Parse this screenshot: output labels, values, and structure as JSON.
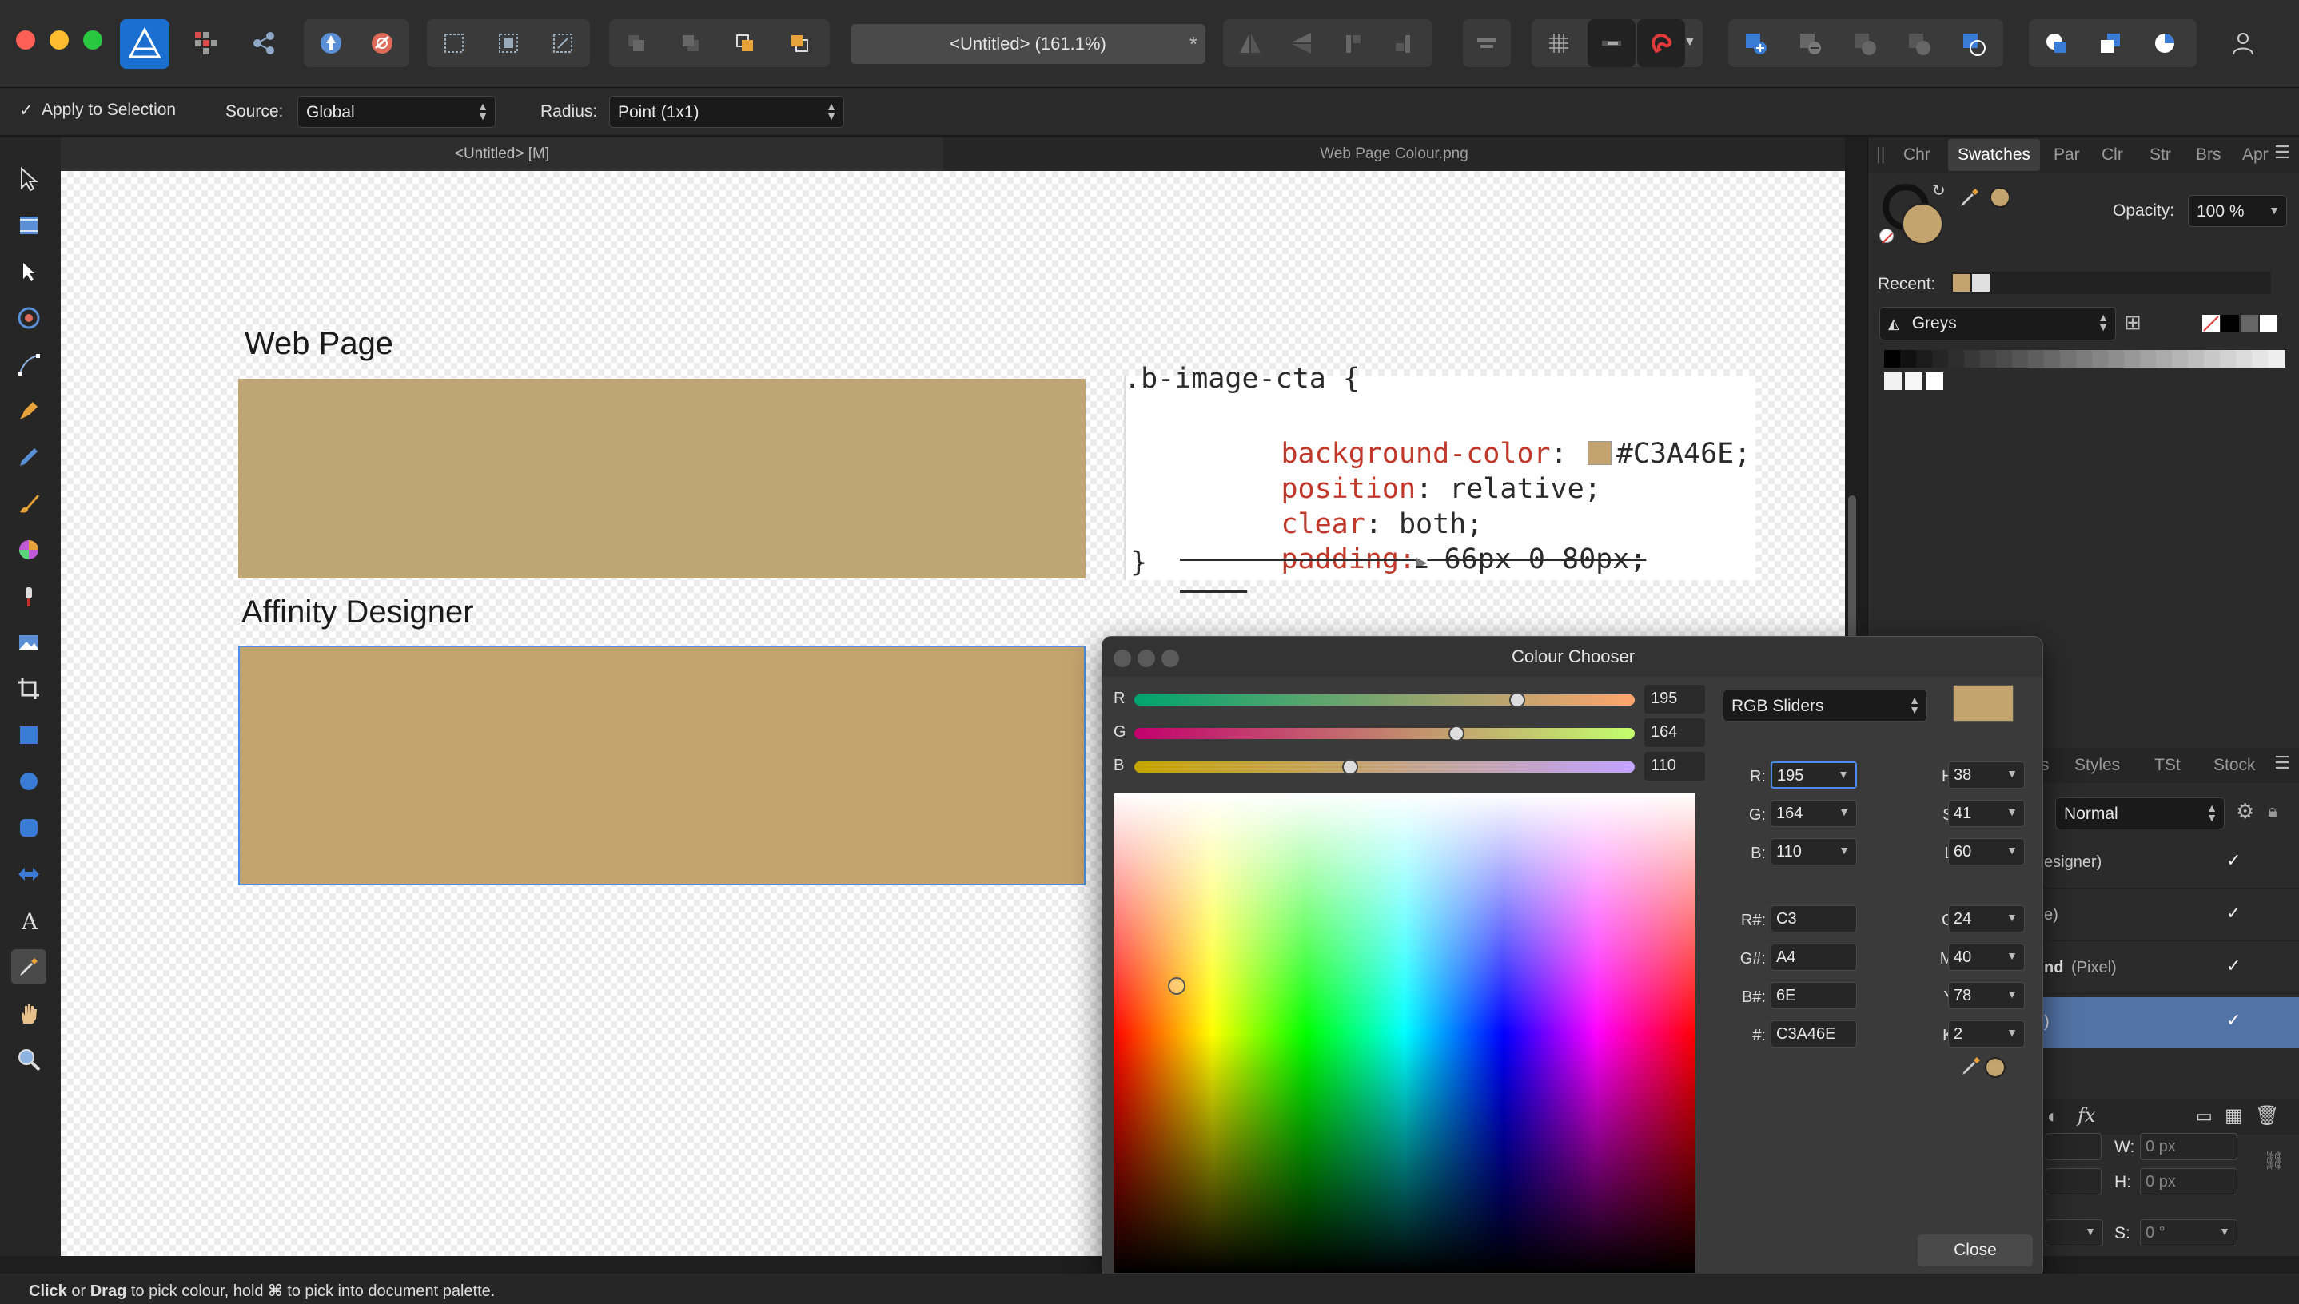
{
  "window": {
    "doc_title": "<Untitled> (161.1%)",
    "title_star": "*"
  },
  "context_bar": {
    "apply_label": "Apply to Selection",
    "apply_check": "✓",
    "source_label": "Source:",
    "source_value": "Global",
    "radius_label": "Radius:",
    "radius_value": "Point (1x1)"
  },
  "doc_tabs": [
    "<Untitled> [M]",
    "Web Page Colour.png"
  ],
  "canvas": {
    "heading_web": "Web Page",
    "heading_affinity": "Affinity Designer",
    "web_color": "#C3A46E",
    "affinity_color": "#C3A46E",
    "code": {
      "line0": ".b-image-cta {",
      "prop1": "background-color",
      "val1": "#C3A46E;",
      "prop2": "position",
      "val2": " relative;",
      "prop3": "clear",
      "val3": " both;",
      "prop4": "padding:",
      "val4": " 66px 0 80px;",
      "close": "}"
    }
  },
  "right_panel": {
    "tabs": [
      "Chr",
      "Swatches",
      "Par",
      "Clr",
      "Str",
      "Brs",
      "Apr"
    ],
    "opacity_label": "Opacity:",
    "opacity_value": "100 %",
    "recent_label": "Recent:",
    "palette_name": "Greys",
    "lower_tabs": [
      "ts",
      "Styles",
      "TSt",
      "Stock"
    ],
    "blend_mode": "Normal",
    "layers": [
      {
        "label": "esigner)",
        "extra": ""
      },
      {
        "label": "e)",
        "extra": ""
      },
      {
        "label": "nd",
        "extra": "(Pixel)"
      },
      {
        "label": ")",
        "extra": ""
      }
    ],
    "layer_check": "✓",
    "transform": {
      "w_label": "W:",
      "w_value": "0 px",
      "h_label": "H:",
      "h_value": "0 px",
      "s_label": "S:",
      "s_value": "0 °"
    },
    "fx_label": "fx"
  },
  "colour_chooser": {
    "title": "Colour Chooser",
    "sliders": [
      {
        "label": "R",
        "value": "195",
        "fraction": 0.765
      },
      {
        "label": "G",
        "value": "164",
        "fraction": 0.643
      },
      {
        "label": "B",
        "value": "110",
        "fraction": 0.431
      }
    ],
    "mode": "RGB Sliders",
    "current_color": "#C3A46E",
    "fields_left": [
      {
        "label": "R:",
        "value": "195"
      },
      {
        "label": "G:",
        "value": "164"
      },
      {
        "label": "B:",
        "value": "110"
      },
      {
        "label": "R#:",
        "value": "C3"
      },
      {
        "label": "G#:",
        "value": "A4"
      },
      {
        "label": "B#:",
        "value": "6E"
      },
      {
        "label": "#:",
        "value": "C3A46E"
      }
    ],
    "fields_right": [
      {
        "label": "H:",
        "value": "38"
      },
      {
        "label": "S:",
        "value": "41"
      },
      {
        "label": "L:",
        "value": "60"
      },
      {
        "label": "C:",
        "value": "24"
      },
      {
        "label": "M:",
        "value": "40"
      },
      {
        "label": "Y:",
        "value": "78"
      },
      {
        "label": "K:",
        "value": "2"
      }
    ],
    "close_label": "Close"
  },
  "status": {
    "click": "Click",
    "or": " or ",
    "drag": "Drag",
    "rest1": " to pick colour, hold ",
    "cmd": "⌘",
    "rest2": " to pick into document palette."
  }
}
